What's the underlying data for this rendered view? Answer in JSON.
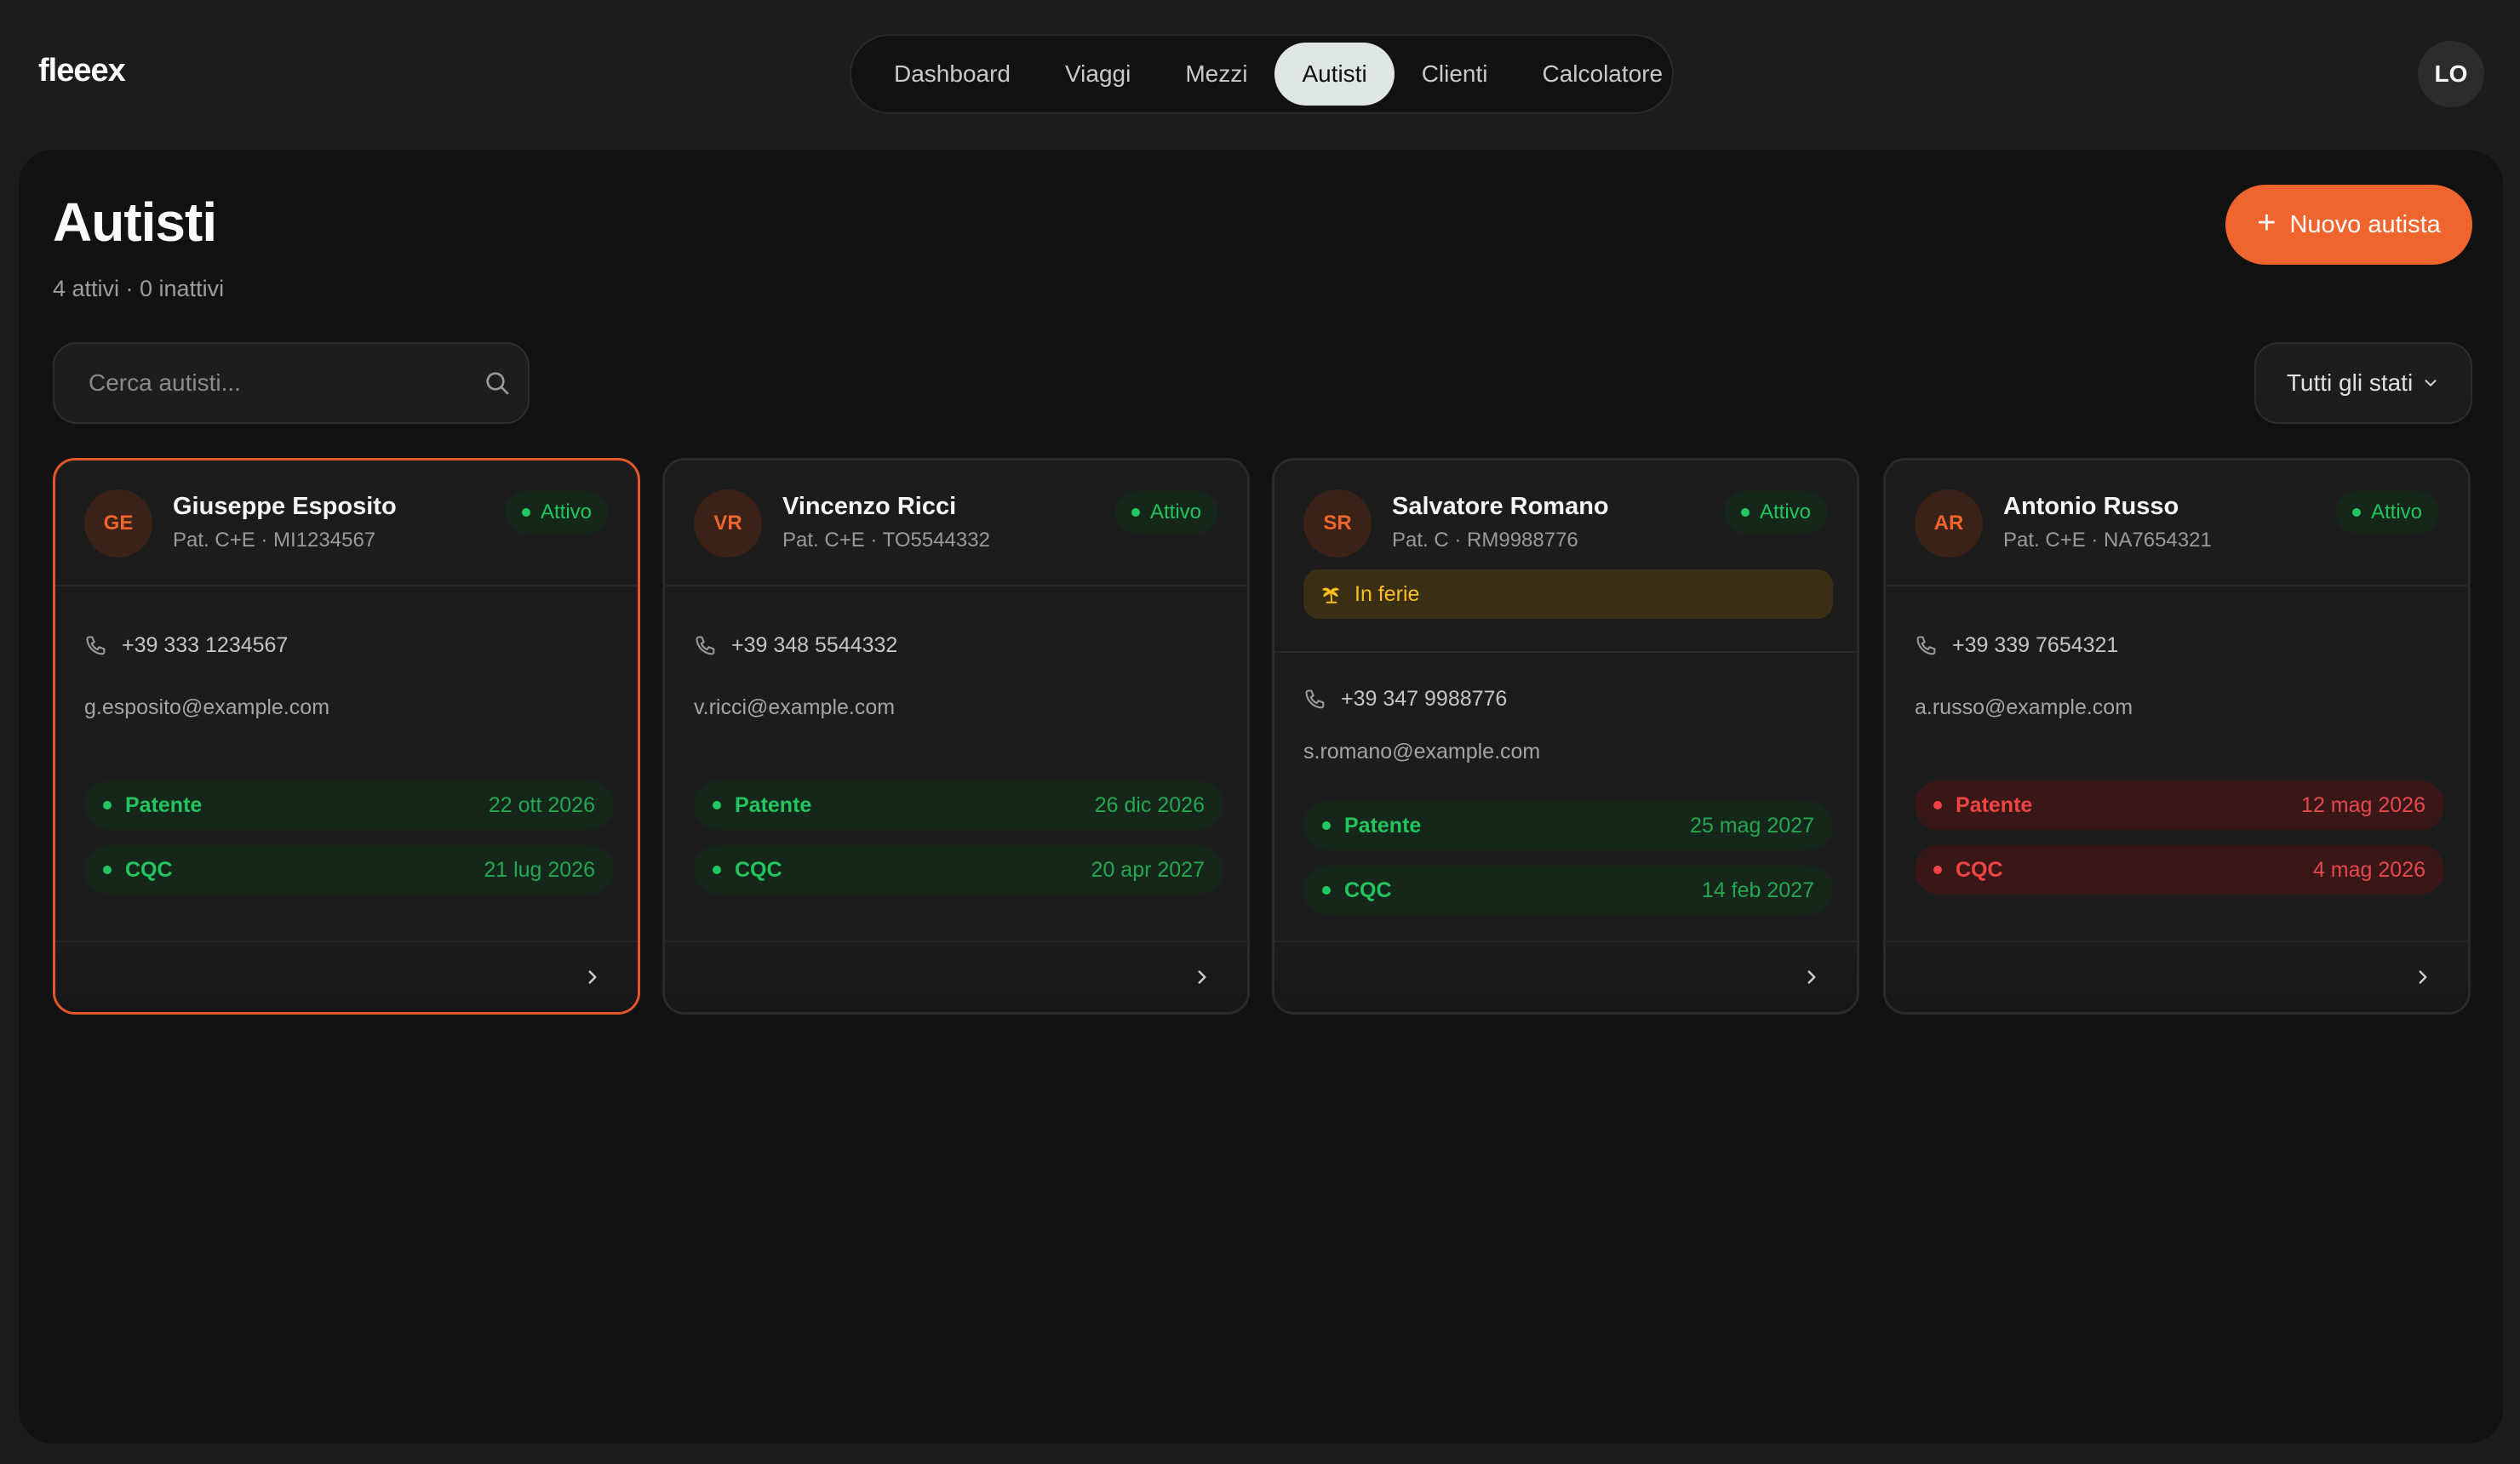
{
  "app": {
    "logo": "fleeex",
    "user_initials": "LO"
  },
  "nav": {
    "tabs": [
      {
        "label": "Dashboard"
      },
      {
        "label": "Viaggi"
      },
      {
        "label": "Mezzi"
      },
      {
        "label": "Autisti",
        "active": true
      },
      {
        "label": "Clienti"
      },
      {
        "label": "Calcolatore"
      }
    ]
  },
  "page": {
    "title": "Autisti",
    "subtitle": "4 attivi · 0 inattivi",
    "new_button_label": "Nuovo autista",
    "search_placeholder": "Cerca autisti...",
    "filter_label": "Tutti gli stati"
  },
  "colors": {
    "accent": "#f0642d",
    "status_ok": "#22c55e",
    "status_warn": "#fbbf24",
    "status_bad": "#ef4444"
  },
  "drivers": [
    {
      "initials": "GE",
      "name": "Giuseppe Esposito",
      "license": "Pat. C+E · MI1234567",
      "status": "Attivo",
      "phone": "+39 333 1234567",
      "email": "g.esposito@example.com",
      "docs": [
        {
          "name": "Patente",
          "date": "22 ott 2026",
          "state": "ok"
        },
        {
          "name": "CQC",
          "date": "21 lug 2026",
          "state": "ok"
        }
      ]
    },
    {
      "initials": "VR",
      "name": "Vincenzo Ricci",
      "license": "Pat. C+E · TO5544332",
      "status": "Attivo",
      "phone": "+39 348 5544332",
      "email": "v.ricci@example.com",
      "docs": [
        {
          "name": "Patente",
          "date": "26 dic 2026",
          "state": "ok"
        },
        {
          "name": "CQC",
          "date": "20 apr 2027",
          "state": "ok"
        }
      ]
    },
    {
      "initials": "SR",
      "name": "Salvatore Romano",
      "license": "Pat. C · RM9988776",
      "status": "Attivo",
      "vacation_label": "In ferie",
      "phone": "+39 347 9988776",
      "email": "s.romano@example.com",
      "docs": [
        {
          "name": "Patente",
          "date": "25 mag 2027",
          "state": "ok"
        },
        {
          "name": "CQC",
          "date": "14 feb 2027",
          "state": "ok"
        }
      ]
    },
    {
      "initials": "AR",
      "name": "Antonio Russo",
      "license": "Pat. C+E · NA7654321",
      "status": "Attivo",
      "phone": "+39 339 7654321",
      "email": "a.russo@example.com",
      "docs": [
        {
          "name": "Patente",
          "date": "12 mag 2026",
          "state": "bad"
        },
        {
          "name": "CQC",
          "date": "4 mag 2026",
          "state": "bad"
        }
      ]
    }
  ]
}
